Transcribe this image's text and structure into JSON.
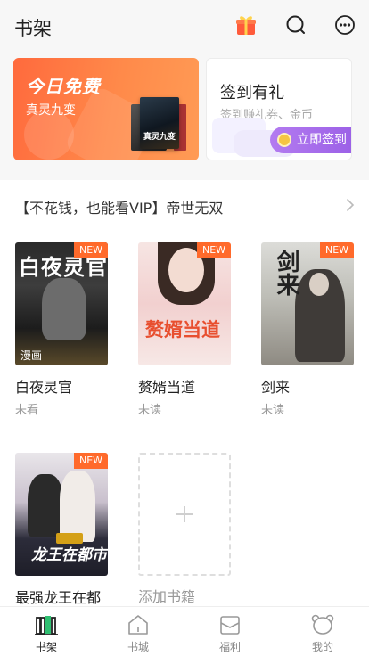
{
  "header": {
    "title": "书架",
    "icons": [
      "gift-icon",
      "search-icon",
      "more-icon"
    ]
  },
  "promo": {
    "free_today": {
      "title": "今日免费",
      "book": "真灵九变",
      "cover_text": "真灵九变"
    },
    "sign_in": {
      "title": "签到有礼",
      "subtitle": "签到赚礼券、金币",
      "button": "立即签到"
    }
  },
  "notice": {
    "text": "【不花钱，也能看VIP】帝世无双"
  },
  "books": [
    {
      "name": "白夜灵官",
      "status": "未看",
      "badge": "NEW",
      "cover_title": "白夜灵官",
      "tag": "漫画"
    },
    {
      "name": "赘婿当道",
      "status": "未读",
      "badge": "NEW",
      "cover_title": "赘婿当道"
    },
    {
      "name": "剑来",
      "status": "未读",
      "badge": "NEW",
      "cover_title": "剑来"
    },
    {
      "name": "最强龙王在都",
      "status": "",
      "badge": "NEW",
      "cover_title": "龙王在都市"
    }
  ],
  "add_book": {
    "label": "添加书籍"
  },
  "tabs": [
    {
      "label": "书架",
      "active": true
    },
    {
      "label": "书城",
      "active": false
    },
    {
      "label": "福利",
      "active": false
    },
    {
      "label": "我的",
      "active": false
    }
  ],
  "colors": {
    "accent": "#ff6a2b",
    "purple": "#a66ae8",
    "green": "#2fbf71"
  }
}
